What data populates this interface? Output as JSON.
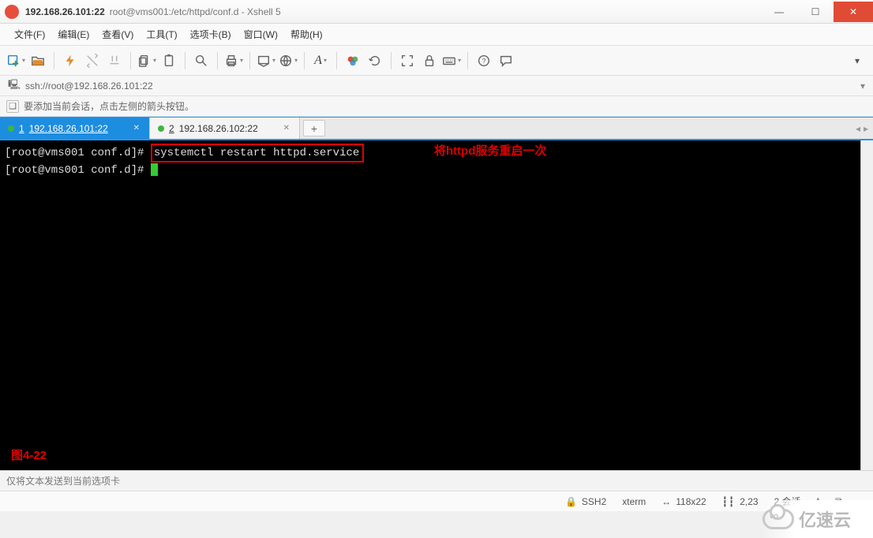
{
  "window": {
    "title_strong": "192.168.26.101:22",
    "title_rest": "root@vms001:/etc/httpd/conf.d - Xshell 5"
  },
  "menu": {
    "file": "文件(F)",
    "edit": "编辑(E)",
    "view": "查看(V)",
    "tools": "工具(T)",
    "tabs": "选项卡(B)",
    "window": "窗口(W)",
    "help": "帮助(H)"
  },
  "address": {
    "url": "ssh://root@192.168.26.101:22"
  },
  "hint": {
    "text": "要添加当前会话，点击左侧的箭头按钮。"
  },
  "tabs": [
    {
      "num": "1",
      "label": "192.168.26.101:22",
      "active": true
    },
    {
      "num": "2",
      "label": "192.168.26.102:22",
      "active": false
    }
  ],
  "terminal": {
    "prompt1": "[root@vms001 conf.d]# ",
    "cmd1": "systemctl restart httpd.service",
    "prompt2": "[root@vms001 conf.d]# ",
    "annotation_right": "将httpd服务重启一次",
    "figure_label": "图4-22"
  },
  "sendbar": {
    "text": "仅将文本发送到当前选项卡"
  },
  "status": {
    "conn": "SSH2",
    "term": "xterm",
    "size": "118x22",
    "pos": "2,23",
    "sessions": "2 会话"
  },
  "watermark": {
    "text": "亿速云"
  }
}
